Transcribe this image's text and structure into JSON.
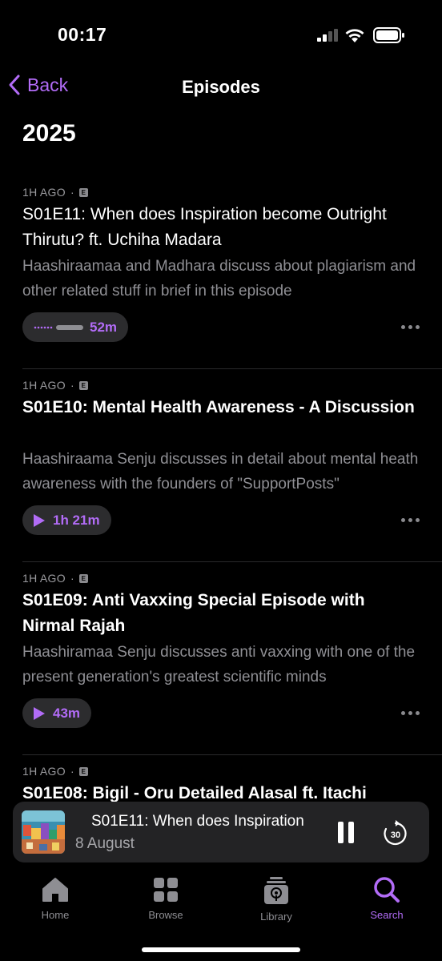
{
  "status": {
    "time": "00:17"
  },
  "nav": {
    "back_label": "Back",
    "title": "Episodes"
  },
  "section_year": "2025",
  "episodes": [
    {
      "age": "1H AGO",
      "explicit": "E",
      "title": "S01E11: When does Inspiration become Outright Thirutu? ft. Uchiha Madara",
      "description": "Haashiraamaa and Madhara discuss about plagiarism and other related stuff in brief in this episode",
      "duration": "52m",
      "in_progress": true
    },
    {
      "age": "1H AGO",
      "explicit": "E",
      "title": "S01E10: Mental Health Awareness - A Discussion",
      "description": "Haashiraama Senju discusses in detail about mental heath awareness with the founders of \"SupportPosts\"",
      "duration": "1h 21m",
      "in_progress": false
    },
    {
      "age": "1H AGO",
      "explicit": "E",
      "title": "S01E09: Anti Vaxxing Special Episode with Nirmal Rajah",
      "description": "Haashiramaa Senju discusses anti vaxxing with one of the present generation's greatest scientific minds",
      "duration": "43m",
      "in_progress": false
    },
    {
      "age": "1H AGO",
      "explicit": "E",
      "title": "S01E08: Bigil - Oru Detailed Alasal ft. Itachi",
      "description": "",
      "duration": "",
      "in_progress": false
    }
  ],
  "mini_player": {
    "title": "S01E11: When does Inspiration",
    "subtitle": "8 August"
  },
  "tabs": [
    {
      "label": "Home",
      "icon": "home-icon"
    },
    {
      "label": "Browse",
      "icon": "grid-icon"
    },
    {
      "label": "Library",
      "icon": "library-icon"
    },
    {
      "label": "Search",
      "icon": "search-icon",
      "active": true
    }
  ],
  "colors": {
    "accent": "#b26cf7",
    "background": "#000000",
    "surface": "#2c2c2e"
  }
}
